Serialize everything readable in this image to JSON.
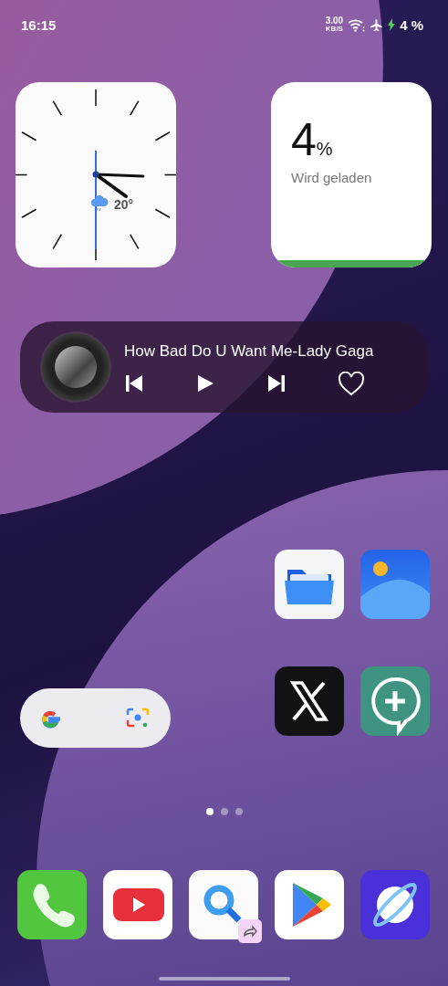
{
  "status_bar": {
    "time": "16:15",
    "net_speed": "3.00",
    "net_unit": "KB/S",
    "battery": "4 %",
    "charging": true
  },
  "clock_widget": {
    "temperature": "20°"
  },
  "battery_widget": {
    "percent": "4",
    "unit": "%",
    "status": "Wird geladen",
    "level": 0.04
  },
  "music_widget": {
    "title": "How Bad Do U Want Me-Lady Gaga",
    "liked": false
  },
  "apps": [
    {
      "kind": "files"
    },
    {
      "kind": "gallery"
    },
    {
      "kind": "x"
    },
    {
      "kind": "chat-plus"
    }
  ],
  "pages": [
    {
      "selected": true
    },
    {
      "selected": false
    },
    {
      "selected": false
    }
  ],
  "dock": [
    {
      "kind": "phone",
      "badge": false
    },
    {
      "kind": "youtube",
      "badge": false
    },
    {
      "kind": "search",
      "badge": true
    },
    {
      "kind": "play",
      "badge": false
    },
    {
      "kind": "browser",
      "badge": false
    }
  ]
}
